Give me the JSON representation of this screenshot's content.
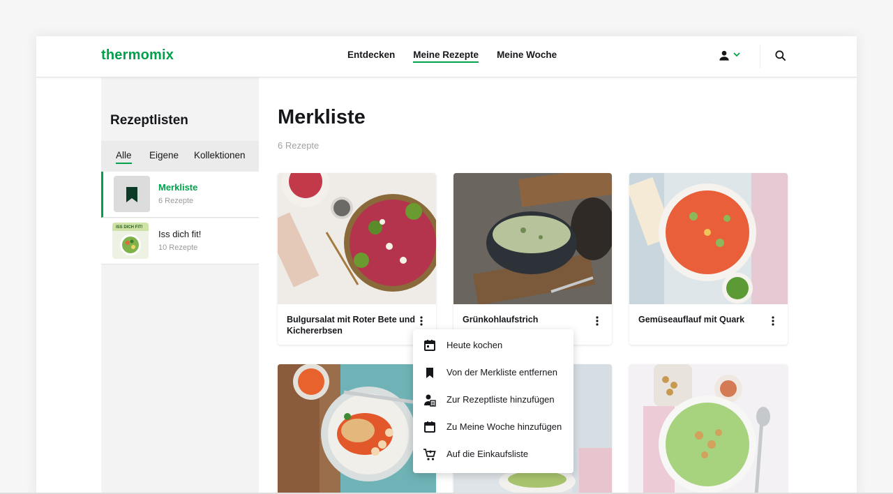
{
  "brand": {
    "logo_text": "thermomix",
    "accent_color": "#00a14b"
  },
  "nav": {
    "items": [
      {
        "label": "Entdecken",
        "active": false
      },
      {
        "label": "Meine Rezepte",
        "active": true
      },
      {
        "label": "Meine Woche",
        "active": false
      }
    ],
    "user_icon": "person-icon",
    "search_icon": "search-icon"
  },
  "sidebar": {
    "title": "Rezeptlisten",
    "filters": [
      {
        "label": "Alle",
        "active": true
      },
      {
        "label": "Eigene",
        "active": false
      },
      {
        "label": "Kollektionen",
        "active": false
      }
    ],
    "lists": [
      {
        "name": "Merkliste",
        "count": "6 Rezepte",
        "selected": true,
        "icon": "bookmark-icon"
      },
      {
        "name": "Iss dich fit!",
        "count": "10 Rezepte",
        "selected": false,
        "thumb_text": "ISS DICH FIT!"
      }
    ]
  },
  "main": {
    "title": "Merkliste",
    "count": "6 Rezepte",
    "cards": [
      {
        "title": "Bulgursalat mit Roter Bete und Kichererbsen"
      },
      {
        "title": "Grünkohlaufstrich"
      },
      {
        "title": "Gemüseauflauf mit Quark"
      },
      {
        "title": ""
      },
      {
        "title": ""
      },
      {
        "title": ""
      }
    ]
  },
  "context_menu": {
    "items": [
      {
        "label": "Heute kochen",
        "icon": "calendar-icon"
      },
      {
        "label": "Von der Merkliste entfernen",
        "icon": "bookmark-icon"
      },
      {
        "label": "Zur Rezeptliste hinzufügen",
        "icon": "add-to-list-icon"
      },
      {
        "label": "Zu Meine Woche hinzufügen",
        "icon": "calendar-icon"
      },
      {
        "label": "Auf die Einkaufsliste",
        "icon": "cart-add-icon"
      }
    ]
  }
}
